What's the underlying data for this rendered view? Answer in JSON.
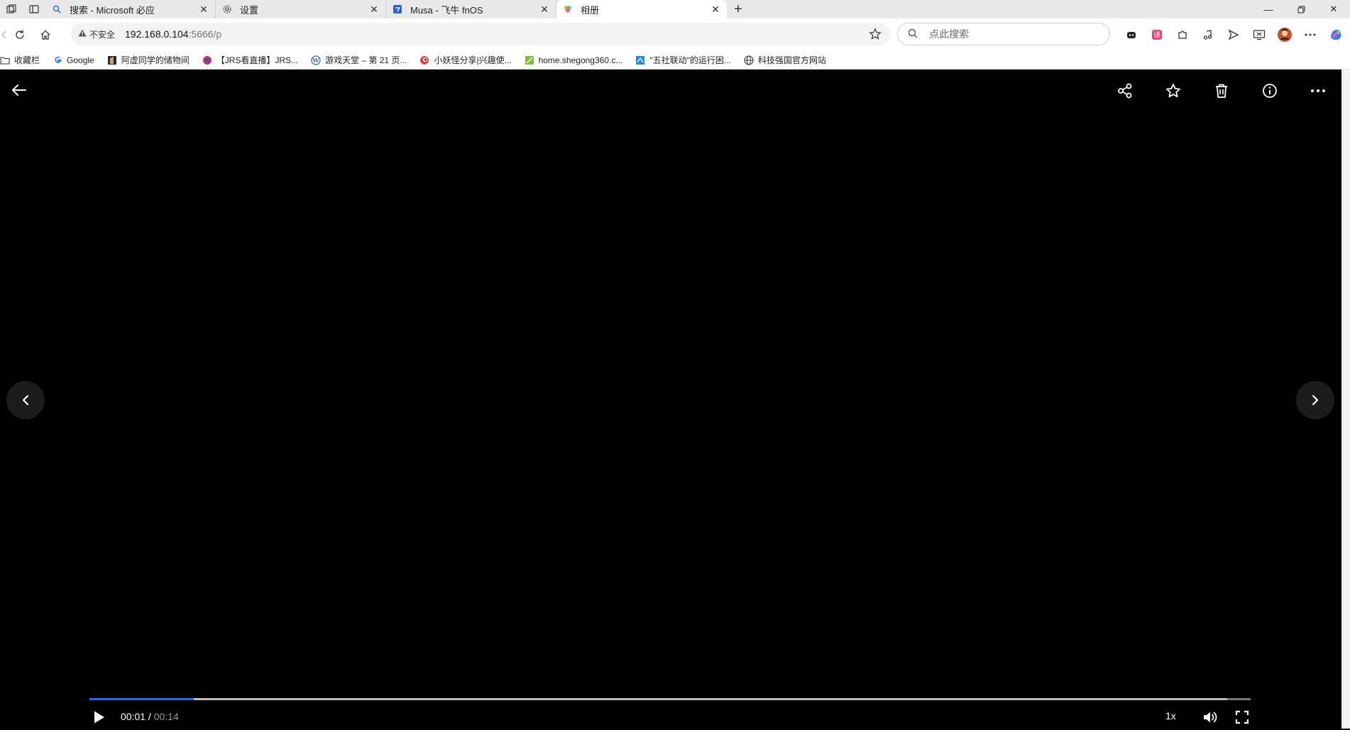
{
  "tabs": [
    {
      "title": "搜索 - Microsoft 必应",
      "active": false,
      "icon": "search-icon"
    },
    {
      "title": "设置",
      "active": false,
      "icon": "gear-icon"
    },
    {
      "title": "Musa - 飞牛 fnOS",
      "active": false,
      "icon": "fnos-icon"
    },
    {
      "title": "相册",
      "active": true,
      "icon": "photos-icon"
    }
  ],
  "address": {
    "security_label": "不安全",
    "host": "192.168.0.104",
    "path": ":5666/p"
  },
  "search": {
    "placeholder": "点此搜索"
  },
  "bookmarks": [
    {
      "label": "收藏栏",
      "icon": "folder-icon"
    },
    {
      "label": "Google",
      "icon": "google-icon"
    },
    {
      "label": "阿虚同学的储物间",
      "icon": "site-icon"
    },
    {
      "label": "【JRS看直播】JRS...",
      "icon": "site-icon"
    },
    {
      "label": "游戏天堂 – 第 21 页...",
      "icon": "wordpress-icon"
    },
    {
      "label": "小妖怪分享|兴趣使...",
      "icon": "site-icon"
    },
    {
      "label": "home.shegong360.c...",
      "icon": "site-icon"
    },
    {
      "label": "\"五社联动\"的运行困...",
      "icon": "site-icon"
    },
    {
      "label": "科技强国官方网站",
      "icon": "globe-icon"
    }
  ],
  "player": {
    "current_time": "00:01",
    "separator": " / ",
    "duration": "00:14",
    "speed": "1x",
    "progress_fraction": 0.09,
    "buffered_fraction": 0.98
  },
  "colors": {
    "progress": "#1a6fe6",
    "background": "#000000"
  }
}
